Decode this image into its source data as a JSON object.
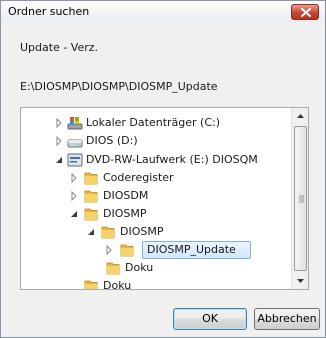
{
  "window": {
    "title": "Ordner suchen"
  },
  "description": "Update - Verz.",
  "path": "E:\\DIOSMP\\DIOSMP\\DIOSMP_Update",
  "tree": {
    "items": [
      {
        "label": "Lokaler Datenträger (C:)",
        "icon": "local-disk-icon",
        "expanded": false
      },
      {
        "label": "DIOS (D:)",
        "icon": "drive-icon",
        "expanded": false
      },
      {
        "label": "DVD-RW-Laufwerk (E:) DIOSQM",
        "icon": "dvd-drive-icon",
        "expanded": true
      },
      {
        "label": "Coderegister",
        "icon": "folder-icon",
        "expanded": false
      },
      {
        "label": "DIOSDM",
        "icon": "folder-icon",
        "expanded": false
      },
      {
        "label": "DIOSMP",
        "icon": "folder-icon",
        "expanded": true
      },
      {
        "label": "DIOSMP",
        "icon": "folder-icon",
        "expanded": true
      },
      {
        "label": "DIOSMP_Update",
        "icon": "folder-icon",
        "expanded": false,
        "selected": true
      },
      {
        "label": "Doku",
        "icon": "folder-icon",
        "expanded": false
      },
      {
        "label": "Doku",
        "icon": "folder-icon",
        "expanded": false
      }
    ]
  },
  "buttons": {
    "ok": "OK",
    "cancel": "Abbrechen"
  },
  "colors": {
    "folder": "#e8b63a",
    "selection": "#d3e7fb",
    "close": "#c84735"
  }
}
